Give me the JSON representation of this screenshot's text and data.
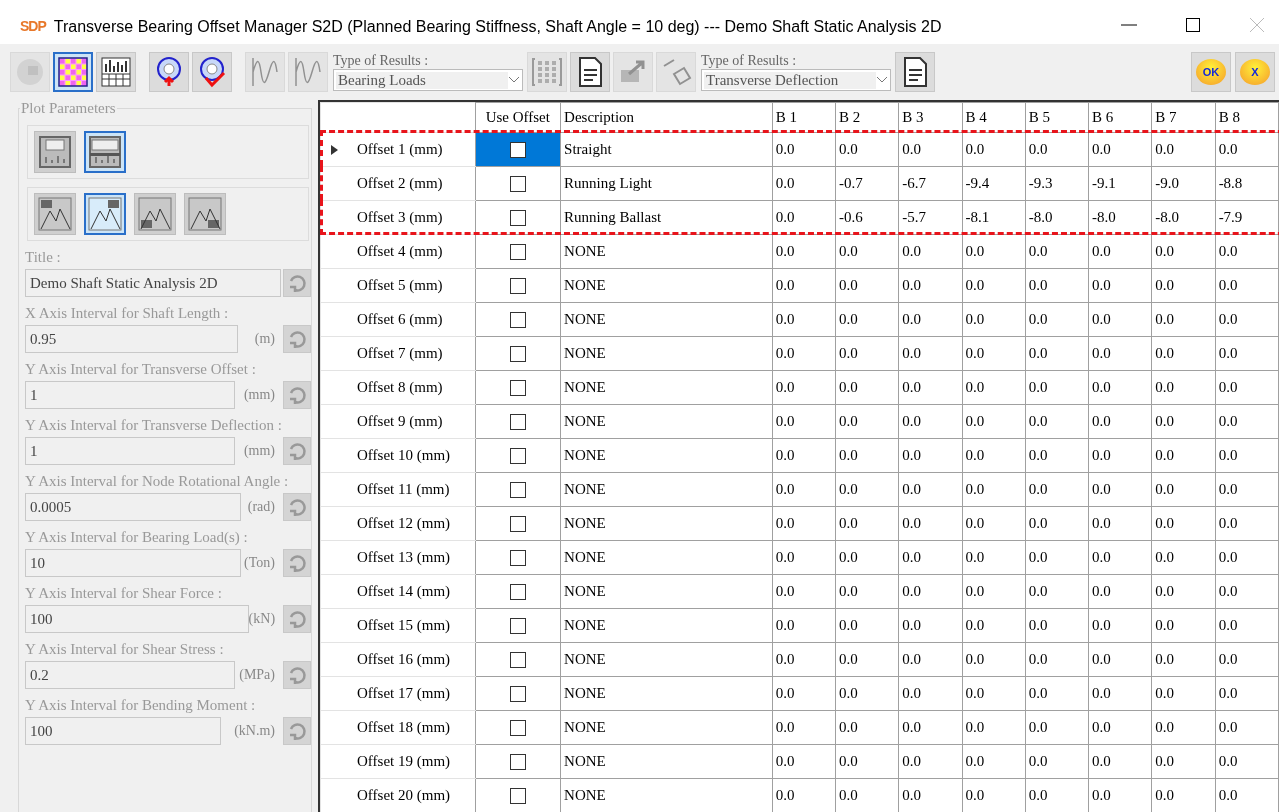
{
  "window": {
    "logo": "SDP",
    "title": "Transverse Bearing Offset Manager S2D (Planned Bearing Stiffness, Shaft Angle = 10 deg) --- Demo Shaft Static Analysis 2D"
  },
  "toolbar": [
    {
      "kind": "button",
      "disabled": true,
      "selected": false
    },
    {
      "kind": "button",
      "disabled": false,
      "selected": true
    },
    {
      "kind": "button",
      "disabled": false,
      "selected": false
    },
    {
      "kind": "gap"
    },
    {
      "kind": "button",
      "disabled": false,
      "selected": false
    },
    {
      "kind": "button",
      "disabled": false,
      "selected": false
    },
    {
      "kind": "gap"
    },
    {
      "kind": "button",
      "disabled": true,
      "selected": false
    },
    {
      "kind": "button",
      "disabled": true,
      "selected": false
    },
    {
      "kind": "dropdown",
      "label": "Type of Results :",
      "value": "Bearing Loads"
    },
    {
      "kind": "button",
      "disabled": true,
      "selected": false
    },
    {
      "kind": "button",
      "disabled": false,
      "selected": false
    },
    {
      "kind": "button",
      "disabled": true,
      "selected": false
    },
    {
      "kind": "button",
      "disabled": true,
      "selected": false
    },
    {
      "kind": "dropdown",
      "label": "Type of Results :",
      "value": "Transverse Deflection"
    },
    {
      "kind": "button",
      "disabled": false,
      "selected": false
    },
    {
      "kind": "spacer"
    },
    {
      "kind": "round",
      "label": "OK"
    },
    {
      "kind": "round",
      "label": "X"
    }
  ],
  "plot_parameters": {
    "title": "Plot Parameters",
    "layout_options": [
      {
        "selected": false
      },
      {
        "selected": true
      }
    ],
    "legend_options": [
      {
        "selected": false
      },
      {
        "selected": true
      },
      {
        "selected": false
      },
      {
        "selected": false
      }
    ],
    "fields": [
      {
        "label": "Title :",
        "value": "Demo Shaft Static Analysis 2D"
      },
      {
        "label": "X Axis Interval for Shaft Length :",
        "value": "0.95",
        "unit": "(m)"
      },
      {
        "label": "Y Axis Interval for Transverse Offset :",
        "value": "1",
        "unit": "(mm)"
      },
      {
        "label": "Y Axis Interval for Transverse Deflection :",
        "value": "1",
        "unit": "(mm)"
      },
      {
        "label": "Y Axis Interval for Node Rotational Angle :",
        "value": "0.0005",
        "unit": "(rad)"
      },
      {
        "label": "Y Axis Interval for Bearing Load(s) :",
        "value": "10",
        "unit": "(Ton)"
      },
      {
        "label": "Y Axis Interval for Shear Force :",
        "value": "100",
        "unit": "(kN)"
      },
      {
        "label": "Y Axis Interval for Shear Stress :",
        "value": "0.2",
        "unit": "(MPa)"
      },
      {
        "label": "Y Axis Interval for Bending Moment :",
        "value": "100",
        "unit": "(kN.m)"
      }
    ]
  },
  "table": {
    "columns": [
      "Use Offset",
      "Description",
      "B 1",
      "B 2",
      "B 3",
      "B 4",
      "B 5",
      "B 6",
      "B 7",
      "B 8"
    ],
    "rows": [
      {
        "name": "Offset 1 (mm)",
        "current": true,
        "highlighted": true,
        "use_offset": false,
        "description": "Straight",
        "values": [
          "0.0",
          "0.0",
          "0.0",
          "0.0",
          "0.0",
          "0.0",
          "0.0",
          "0.0"
        ]
      },
      {
        "name": "Offset 2 (mm)",
        "current": false,
        "highlighted": true,
        "use_offset": false,
        "description": "Running Light",
        "values": [
          "0.0",
          "-0.7",
          "-6.7",
          "-9.4",
          "-9.3",
          "-9.1",
          "-9.0",
          "-8.8"
        ]
      },
      {
        "name": "Offset 3 (mm)",
        "current": false,
        "highlighted": true,
        "use_offset": false,
        "description": "Running Ballast",
        "values": [
          "0.0",
          "-0.6",
          "-5.7",
          "-8.1",
          "-8.0",
          "-8.0",
          "-8.0",
          "-7.9"
        ]
      },
      {
        "name": "Offset 4 (mm)",
        "current": false,
        "highlighted": false,
        "use_offset": false,
        "description": "NONE",
        "values": [
          "0.0",
          "0.0",
          "0.0",
          "0.0",
          "0.0",
          "0.0",
          "0.0",
          "0.0"
        ]
      },
      {
        "name": "Offset 5 (mm)",
        "current": false,
        "highlighted": false,
        "use_offset": false,
        "description": "NONE",
        "values": [
          "0.0",
          "0.0",
          "0.0",
          "0.0",
          "0.0",
          "0.0",
          "0.0",
          "0.0"
        ]
      },
      {
        "name": "Offset 6 (mm)",
        "current": false,
        "highlighted": false,
        "use_offset": false,
        "description": "NONE",
        "values": [
          "0.0",
          "0.0",
          "0.0",
          "0.0",
          "0.0",
          "0.0",
          "0.0",
          "0.0"
        ]
      },
      {
        "name": "Offset 7 (mm)",
        "current": false,
        "highlighted": false,
        "use_offset": false,
        "description": "NONE",
        "values": [
          "0.0",
          "0.0",
          "0.0",
          "0.0",
          "0.0",
          "0.0",
          "0.0",
          "0.0"
        ]
      },
      {
        "name": "Offset 8 (mm)",
        "current": false,
        "highlighted": false,
        "use_offset": false,
        "description": "NONE",
        "values": [
          "0.0",
          "0.0",
          "0.0",
          "0.0",
          "0.0",
          "0.0",
          "0.0",
          "0.0"
        ]
      },
      {
        "name": "Offset 9 (mm)",
        "current": false,
        "highlighted": false,
        "use_offset": false,
        "description": "NONE",
        "values": [
          "0.0",
          "0.0",
          "0.0",
          "0.0",
          "0.0",
          "0.0",
          "0.0",
          "0.0"
        ]
      },
      {
        "name": "Offset 10 (mm)",
        "current": false,
        "highlighted": false,
        "use_offset": false,
        "description": "NONE",
        "values": [
          "0.0",
          "0.0",
          "0.0",
          "0.0",
          "0.0",
          "0.0",
          "0.0",
          "0.0"
        ]
      },
      {
        "name": "Offset 11 (mm)",
        "current": false,
        "highlighted": false,
        "use_offset": false,
        "description": "NONE",
        "values": [
          "0.0",
          "0.0",
          "0.0",
          "0.0",
          "0.0",
          "0.0",
          "0.0",
          "0.0"
        ]
      },
      {
        "name": "Offset 12 (mm)",
        "current": false,
        "highlighted": false,
        "use_offset": false,
        "description": "NONE",
        "values": [
          "0.0",
          "0.0",
          "0.0",
          "0.0",
          "0.0",
          "0.0",
          "0.0",
          "0.0"
        ]
      },
      {
        "name": "Offset 13 (mm)",
        "current": false,
        "highlighted": false,
        "use_offset": false,
        "description": "NONE",
        "values": [
          "0.0",
          "0.0",
          "0.0",
          "0.0",
          "0.0",
          "0.0",
          "0.0",
          "0.0"
        ]
      },
      {
        "name": "Offset 14 (mm)",
        "current": false,
        "highlighted": false,
        "use_offset": false,
        "description": "NONE",
        "values": [
          "0.0",
          "0.0",
          "0.0",
          "0.0",
          "0.0",
          "0.0",
          "0.0",
          "0.0"
        ]
      },
      {
        "name": "Offset 15 (mm)",
        "current": false,
        "highlighted": false,
        "use_offset": false,
        "description": "NONE",
        "values": [
          "0.0",
          "0.0",
          "0.0",
          "0.0",
          "0.0",
          "0.0",
          "0.0",
          "0.0"
        ]
      },
      {
        "name": "Offset 16 (mm)",
        "current": false,
        "highlighted": false,
        "use_offset": false,
        "description": "NONE",
        "values": [
          "0.0",
          "0.0",
          "0.0",
          "0.0",
          "0.0",
          "0.0",
          "0.0",
          "0.0"
        ]
      },
      {
        "name": "Offset 17 (mm)",
        "current": false,
        "highlighted": false,
        "use_offset": false,
        "description": "NONE",
        "values": [
          "0.0",
          "0.0",
          "0.0",
          "0.0",
          "0.0",
          "0.0",
          "0.0",
          "0.0"
        ]
      },
      {
        "name": "Offset 18 (mm)",
        "current": false,
        "highlighted": false,
        "use_offset": false,
        "description": "NONE",
        "values": [
          "0.0",
          "0.0",
          "0.0",
          "0.0",
          "0.0",
          "0.0",
          "0.0",
          "0.0"
        ]
      },
      {
        "name": "Offset 19 (mm)",
        "current": false,
        "highlighted": false,
        "use_offset": false,
        "description": "NONE",
        "values": [
          "0.0",
          "0.0",
          "0.0",
          "0.0",
          "0.0",
          "0.0",
          "0.0",
          "0.0"
        ]
      },
      {
        "name": "Offset 20 (mm)",
        "current": false,
        "highlighted": false,
        "use_offset": false,
        "description": "NONE",
        "values": [
          "0.0",
          "0.0",
          "0.0",
          "0.0",
          "0.0",
          "0.0",
          "0.0",
          "0.0"
        ]
      }
    ]
  }
}
